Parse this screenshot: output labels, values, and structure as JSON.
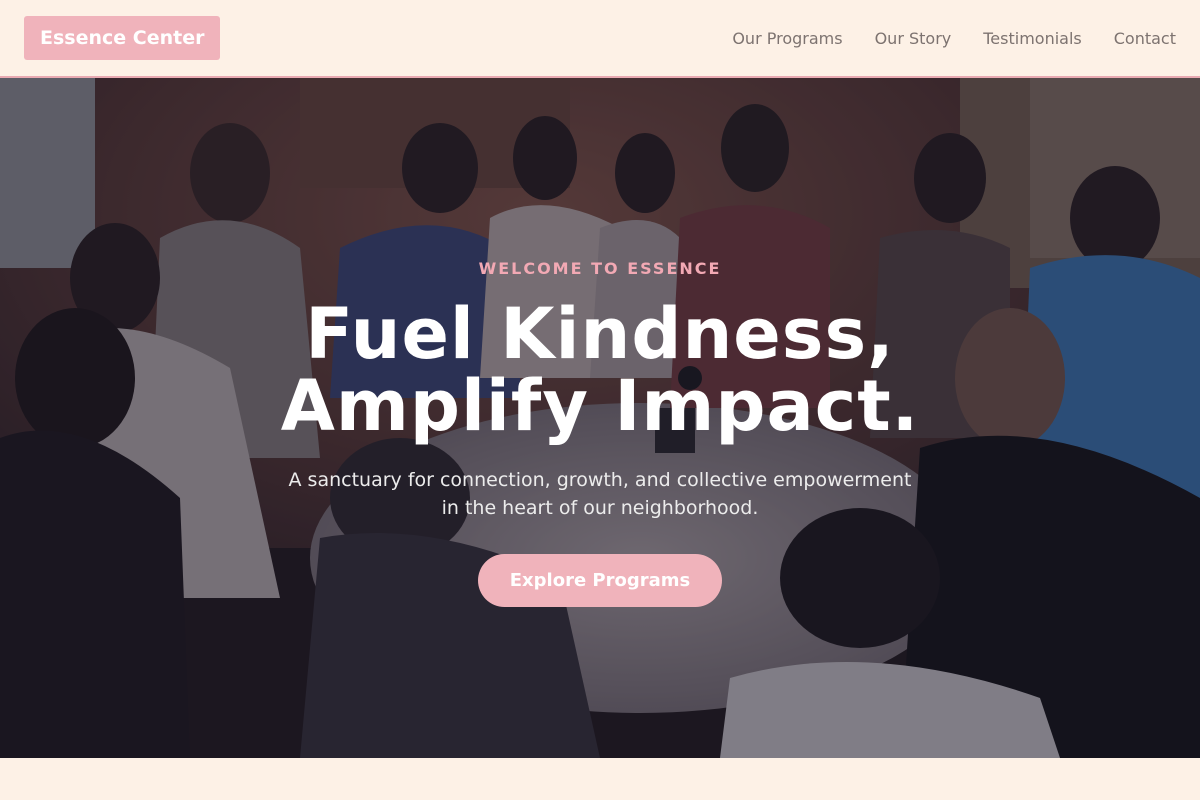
{
  "nav": {
    "brand": "Essence Center",
    "links": [
      "Our Programs",
      "Our Story",
      "Testimonials",
      "Contact"
    ]
  },
  "hero": {
    "eyebrow": "WELCOME TO ESSENCE",
    "headline_line1": "Fuel Kindness,",
    "headline_line2": "Amplify Impact.",
    "subtext_line1": "A sanctuary for connection, growth, and collective empowerment",
    "subtext_line2": "in the heart of our neighborhood.",
    "cta_label": "Explore Programs"
  },
  "colors": {
    "accent_pink": "#f0b3bb",
    "eyebrow_pink": "#f2a9b4",
    "page_bg": "#fdf1e6",
    "nav_text": "#7d7370"
  }
}
